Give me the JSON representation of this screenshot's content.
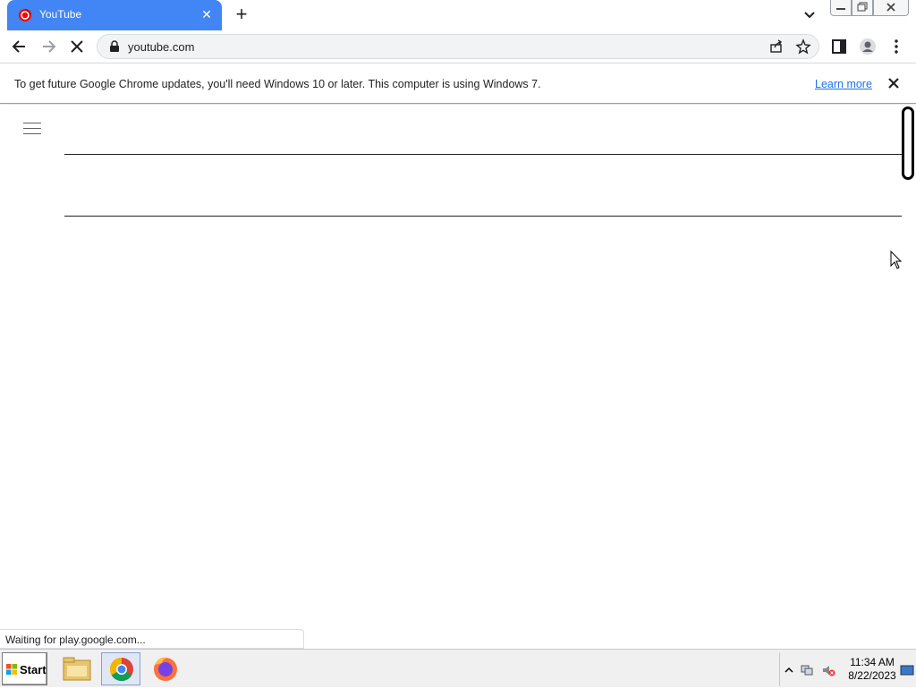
{
  "browser": {
    "tab": {
      "title": "YouTube"
    },
    "address": {
      "url": "youtube.com"
    }
  },
  "infobar": {
    "message": "To get future Google Chrome updates, you'll need Windows 10 or later. This computer is using Windows 7.",
    "learn_more": "Learn more"
  },
  "status_bar": {
    "text": "Waiting for play.google.com..."
  },
  "taskbar": {
    "start_label": "Start",
    "apps": [
      "file-explorer-icon",
      "chrome-icon",
      "firefox-icon"
    ],
    "clock": {
      "time": "11:34 AM",
      "date": "8/22/2023"
    }
  },
  "colors": {
    "tab_active": "#4285f4",
    "link": "#1a73e8",
    "youtube_red": "#ff0000"
  }
}
